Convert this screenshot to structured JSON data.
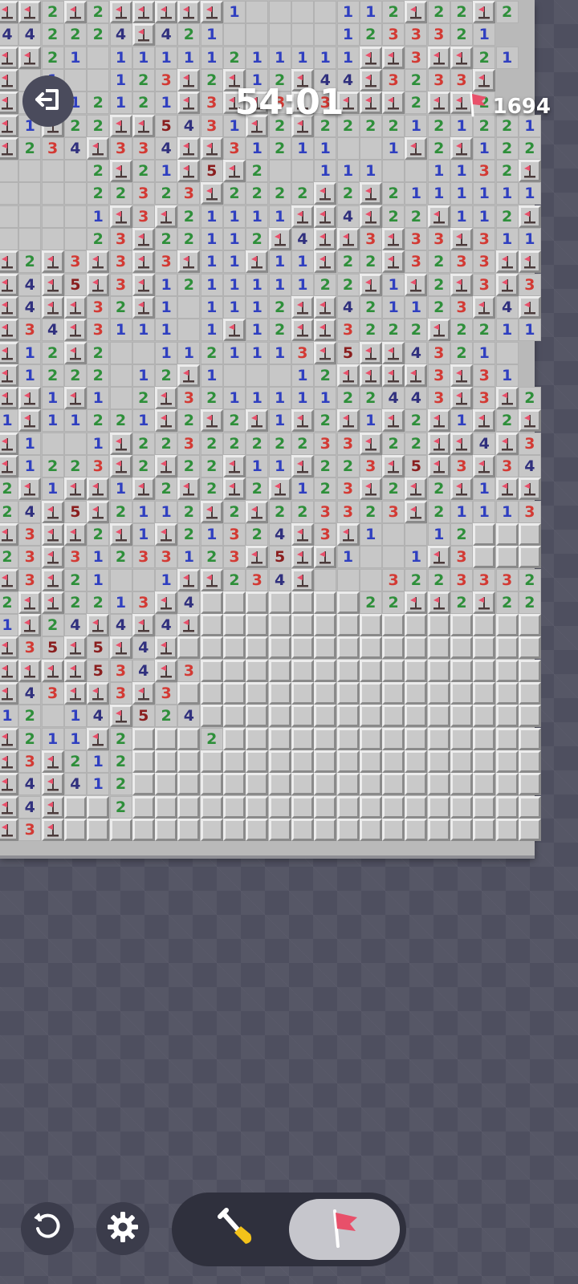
{
  "header": {
    "timer": "54:01",
    "flags_remaining": "1694",
    "exit_icon": "exit-icon",
    "flag_icon": "flag-icon"
  },
  "controls": {
    "restart_icon": "restart-icon",
    "settings_icon": "gear-icon",
    "dig_mode_icon": "shovel-icon",
    "flag_mode_icon": "flag-icon",
    "active_mode": "flag"
  },
  "colors": {
    "n1": "#2f3fc0",
    "n2": "#2e8f3a",
    "n3": "#d33a34",
    "n4": "#30307e",
    "n5": "#8a1e1e",
    "flag": "#e8506a",
    "background": "#4e4f5f"
  },
  "board": {
    "legend": "digit = revealed number, F = flag, . = revealed empty, # = unopened",
    "rows": [
      "FF2F2FFFFF1....112F22F2",
      "442224F421.....1233321",
      "FF21.11111211111FF3FF21",
      "F.1..123F2F12F44F3233F",
      "F2F12121F3FF3F3FFF2FF2",
      "F1F22FF5431F2F2222121221F",
      "F234F334FF31211..1F2F122",
      "....2F21F5F2..111..1132F33F",
      "....22323F2222F2F2111111F3FF",
      "....1F3F21111FF4F22F112F32",
      "....23F22112F4FF3F33F31111",
      "F2F3F3F3F11F11F22F3233FF2F1222",
      "F4F5F3F121111122F1F2F3F3F4FF",
      "F4FF32F1.1112FF421123F4F3",
      "F34F3111.1F12FF3222F2211",
      "F12F2..1121113F5FF4321.",
      "F1222.12F1...12FFFF3F31",
      "FF1F1.2F321111122443F3F21",
      "1F11221F2F2F1F2F1F2F1F2F11242",
      "F1..1F2232222233F22FF4F3F12F3",
      "F1223F2F22F11F223F5F3F34F32",
      "2F1FF1F2F2F2F123F2F2F1FF3FFF34",
      "24F5F2112F2F223323F21113F###",
      "F3FF2F1F21324F3F1..12###",
      "23F31233123F5FF1..1F3###",
      "F3F21..1FF234F...32233322###",
      "2FF2213F4#######22FF2F22###",
      "1F24F4F4F###################",
      "F35F5F4F####################",
      "FFFF534F3###################",
      "F43FF3F3####################",
      "12.14F524###################",
      "F211F2###2##################",
      "F3F212######################",
      "F4F412######################",
      "F4F##2######################",
      "F3F#########################"
    ]
  }
}
